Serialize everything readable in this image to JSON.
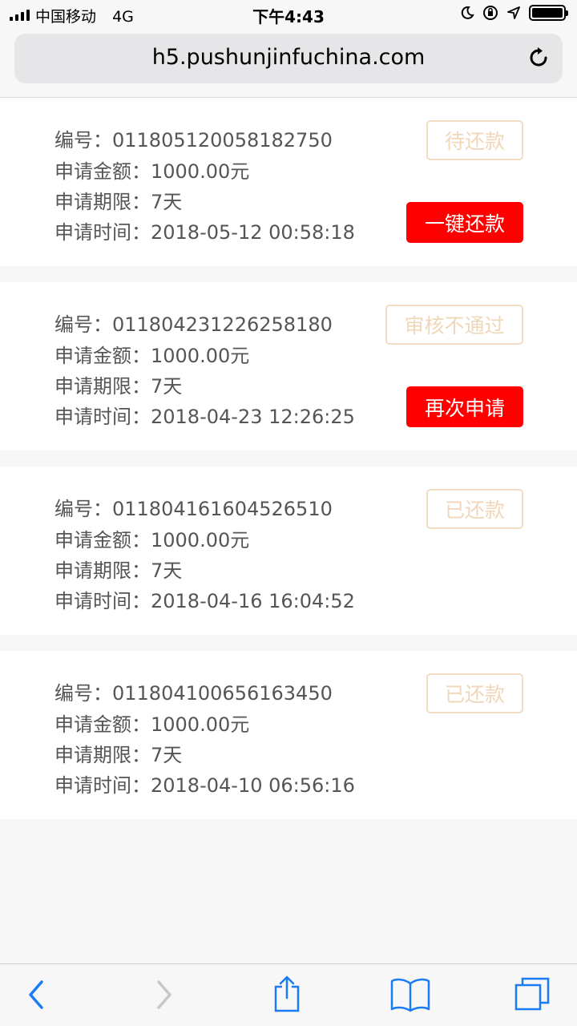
{
  "status_bar": {
    "carrier": "中国移动",
    "network": "4G",
    "time": "下午4:43"
  },
  "browser": {
    "url": "h5.pushunjinfuchina.com"
  },
  "labels": {
    "id": "编号：",
    "amount": "申请金额：",
    "term": "申请期限：",
    "time": "申请时间："
  },
  "records": [
    {
      "id": "011805120058182750",
      "amount": "1000.00元",
      "term": "7天",
      "time": "2018-05-12 00:58:18",
      "status": "待还款",
      "action": "一键还款"
    },
    {
      "id": "011804231226258180",
      "amount": "1000.00元",
      "term": "7天",
      "time": "2018-04-23 12:26:25",
      "status": "审核不通过",
      "action": "再次申请"
    },
    {
      "id": "011804161604526510",
      "amount": "1000.00元",
      "term": "7天",
      "time": "2018-04-16 16:04:52",
      "status": "已还款"
    },
    {
      "id": "011804100656163450",
      "amount": "1000.00元",
      "term": "7天",
      "time": "2018-04-10 06:56:16",
      "status": "已还款"
    }
  ],
  "colors": {
    "action_button": "#fe0000",
    "status_tag_border": "#f2dcc3",
    "status_tag_text": "#f0d7ba",
    "ios_blue": "#1a7cf5"
  },
  "toolbar": {
    "icons": [
      "back-icon",
      "forward-icon",
      "share-icon",
      "bookmarks-icon",
      "tabs-icon"
    ]
  }
}
